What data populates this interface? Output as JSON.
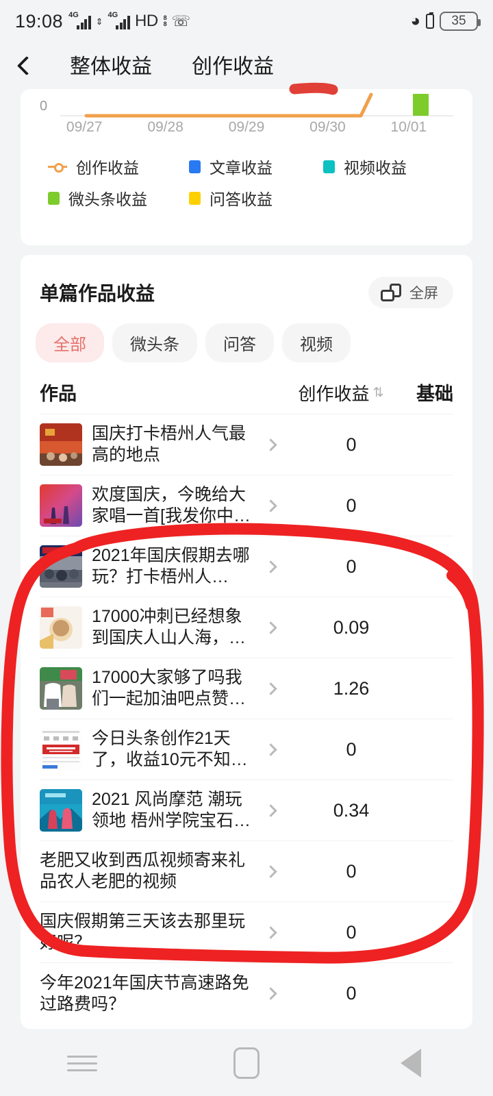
{
  "status_bar": {
    "time": "19:08",
    "network_1": "4G",
    "network_2": "4G",
    "hd_label": "HD",
    "hd_sub_top": "8",
    "hd_sub_bottom": "8",
    "phone_icon": "phone-call-icon",
    "bluetooth_icon": "bluetooth-icon",
    "second_battery_icon": "small-battery-icon",
    "battery_level": "35"
  },
  "nav": {
    "back_icon": "back-chevron-icon",
    "tabs": [
      {
        "label": "整体收益",
        "active": false
      },
      {
        "label": "创作收益",
        "active": true
      }
    ]
  },
  "chart_data": {
    "type": "line",
    "title": "",
    "xlabel": "",
    "ylabel": "",
    "categories": [
      "09/27",
      "09/28",
      "09/29",
      "09/30",
      "10/01"
    ],
    "y_tick_labels": [
      "0"
    ],
    "ylim": [
      0,
      1.5
    ],
    "grid": false,
    "legend_position": "bottom",
    "series": [
      {
        "name": "创作收益",
        "color": "#f0a04b",
        "marker": "line",
        "values": [
          0,
          0,
          0,
          0,
          1.26
        ]
      },
      {
        "name": "文章收益",
        "color": "#2979f2",
        "marker": "square",
        "values": [
          0,
          0,
          0,
          0,
          0
        ]
      },
      {
        "name": "视频收益",
        "color": "#0bc1c1",
        "marker": "square",
        "values": [
          0,
          0,
          0,
          0,
          0
        ]
      },
      {
        "name": "微头条收益",
        "color": "#7ecb2c",
        "marker": "square",
        "values": [
          0,
          0,
          0,
          0,
          1.26
        ]
      },
      {
        "name": "问答收益",
        "color": "#fdd000",
        "marker": "square",
        "values": [
          0,
          0,
          0,
          0,
          0
        ]
      }
    ]
  },
  "list_card": {
    "title": "单篇作品收益",
    "fullscreen_icon": "rotate-fullscreen-icon",
    "fullscreen_label": "全屏",
    "chips": [
      {
        "label": "全部",
        "active": true
      },
      {
        "label": "微头条",
        "active": false
      },
      {
        "label": "问答",
        "active": false
      },
      {
        "label": "视频",
        "active": false
      }
    ],
    "columns": {
      "work": "作品",
      "income": "创作收益",
      "sort_icon": "sort-updown-icon",
      "base": "基础"
    },
    "rows": [
      {
        "title": "国庆打卡梧州人气最高的地点",
        "value": "0",
        "thumb": "c1",
        "has_thumb": true
      },
      {
        "title": "欢度国庆，今晚给大家唱一首[我发你中…",
        "value": "0",
        "thumb": "c2",
        "has_thumb": true
      },
      {
        "title": "2021年国庆假期去哪玩？打卡梧州人…",
        "value": "0",
        "thumb": "c3",
        "has_thumb": true
      },
      {
        "title": "17000冲刺已经想象到国庆人山人海，…",
        "value": "0.09",
        "thumb": "c4",
        "has_thumb": true
      },
      {
        "title": "17000大家够了吗我们一起加油吧点赞…",
        "value": "1.26",
        "thumb": "c5",
        "has_thumb": true
      },
      {
        "title": "今日头条创作21天了，收益10元不知…",
        "value": "0",
        "thumb": "c6",
        "has_thumb": true
      },
      {
        "title": "2021 风尚摩范 潮玩领地 梧州学院宝石…",
        "value": "0.34",
        "thumb": "c7",
        "has_thumb": true
      },
      {
        "title": "老肥又收到西瓜视频寄来礼品农人老肥的视频",
        "value": "0",
        "thumb": "",
        "has_thumb": false
      },
      {
        "title": "国庆假期第三天该去那里玩好呢？",
        "value": "0",
        "thumb": "",
        "has_thumb": false
      },
      {
        "title": "今年2021年国庆节高速路免过路费吗？",
        "value": "0",
        "thumb": "",
        "has_thumb": false
      }
    ]
  },
  "annotation": {
    "color": "#ee2222",
    "shape": "hand-drawn-circle"
  },
  "system_nav": {
    "menu_icon": "menu-icon",
    "home_icon": "home-icon",
    "back_icon": "back-triangle-icon"
  },
  "colors": {
    "background": "#f3f4f5",
    "card": "#ffffff",
    "accent_pink": "#fdeaea",
    "accent_red": "#e4726b",
    "line_orange": "#f0a04b",
    "bar_green": "#7ecb2c",
    "annotation_red": "#ee2222"
  }
}
